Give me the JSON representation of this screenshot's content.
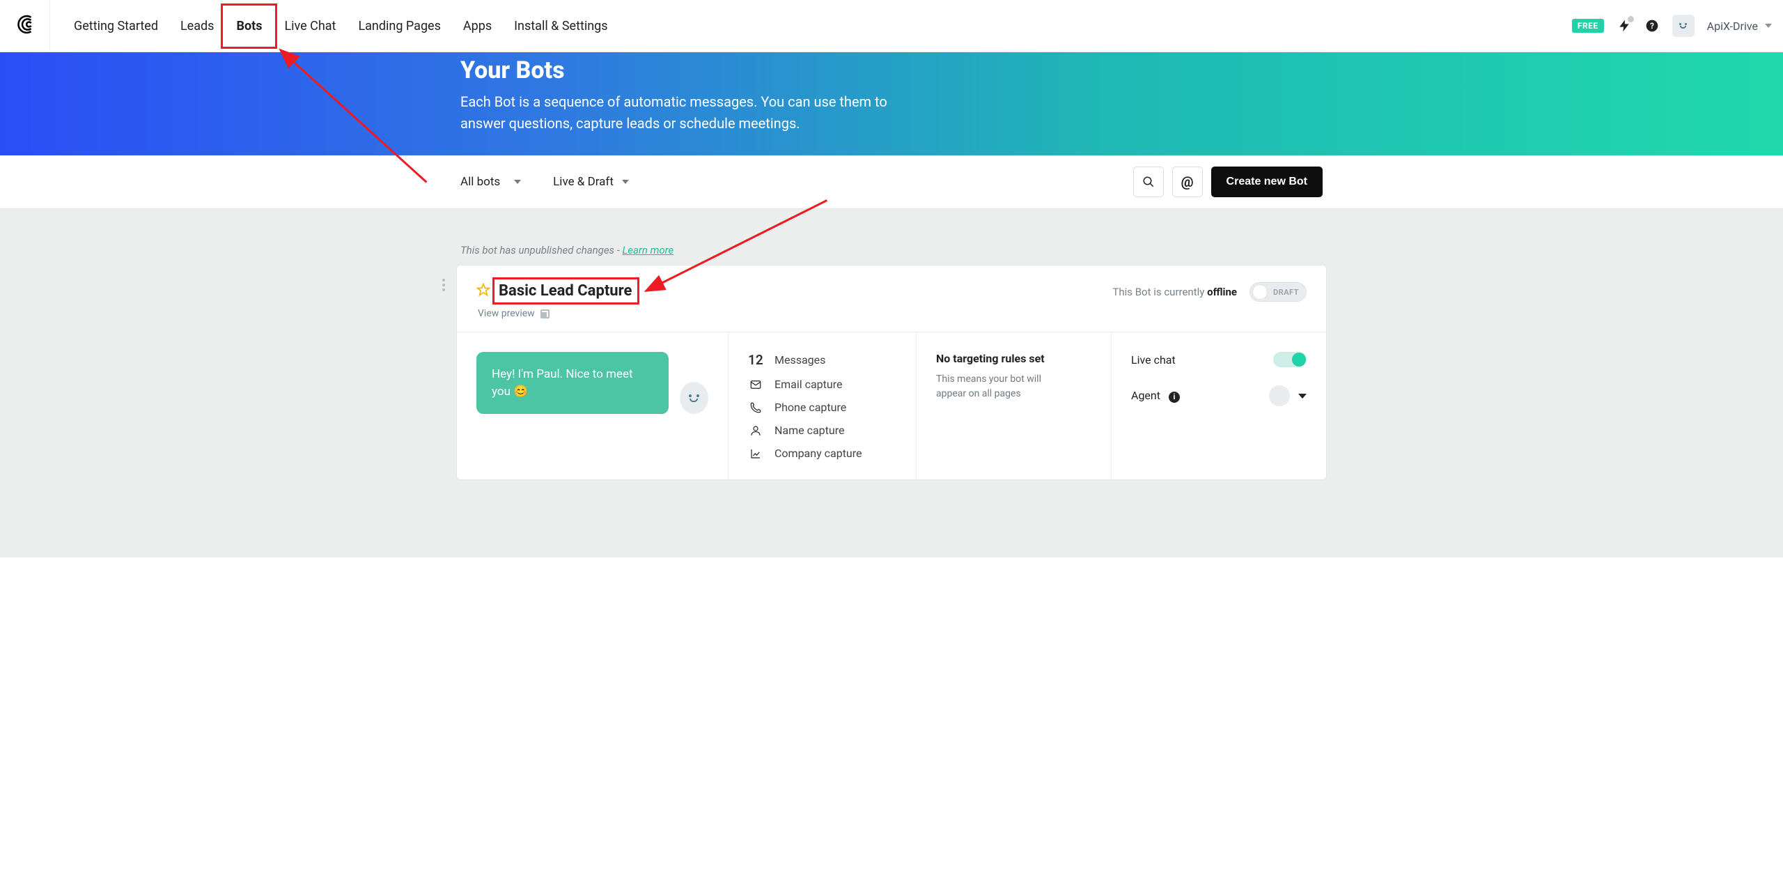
{
  "nav": {
    "items": [
      "Getting Started",
      "Leads",
      "Bots",
      "Live Chat",
      "Landing Pages",
      "Apps",
      "Install & Settings"
    ],
    "active_index": 2,
    "free_badge": "FREE",
    "username": "ApiX-Drive"
  },
  "hero": {
    "title": "Your Bots",
    "subtitle": "Each Bot is a sequence of automatic messages. You can use them to answer questions, capture leads or schedule meetings."
  },
  "toolbar": {
    "filter1": "All bots",
    "filter2": "Live & Draft",
    "create_btn": "Create new Bot",
    "at_symbol": "@"
  },
  "notice": {
    "text": "This bot has unpublished changes -",
    "link": "Learn more"
  },
  "bot": {
    "title": "Basic Lead Capture",
    "view_preview": "View preview",
    "status_prefix": "This Bot is currently",
    "status_value": "offline",
    "pill_label": "DRAFT",
    "bubble_text": "Hey! I'm Paul. Nice to meet you 😊",
    "features": {
      "count": "12",
      "messages": "Messages",
      "email": "Email capture",
      "phone": "Phone capture",
      "name": "Name capture",
      "company": "Company capture"
    },
    "targeting": {
      "title": "No targeting rules set",
      "sub": "This means your bot will appear on all pages"
    },
    "settings": {
      "live_chat": "Live chat",
      "agent": "Agent",
      "info": "i"
    }
  }
}
